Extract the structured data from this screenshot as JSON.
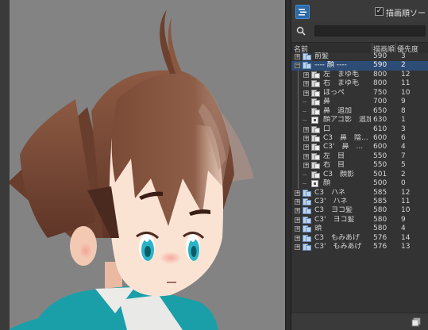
{
  "panel": {
    "draw_order_sort_label": "描画順ソート",
    "draw_order_sort_checked": "✓",
    "search_placeholder": "",
    "columns": {
      "name": "名前",
      "order": "描画順",
      "priority": "優先度"
    }
  },
  "parts": [
    {
      "name": "前髪",
      "order": "590",
      "priority": "3",
      "depth": 0,
      "expander": "+",
      "icon": "folder",
      "selected": false
    },
    {
      "name": "---- 顔 ----",
      "order": "590",
      "priority": "2",
      "depth": 0,
      "expander": "−",
      "icon": "folder",
      "selected": true
    },
    {
      "name": "左　まゆ毛",
      "order": "800",
      "priority": "12",
      "depth": 1,
      "expander": "+",
      "icon": "part",
      "selected": false
    },
    {
      "name": "右　まゆ毛",
      "order": "800",
      "priority": "11",
      "depth": 1,
      "expander": "+",
      "icon": "part",
      "selected": false
    },
    {
      "name": "ほっぺ",
      "order": "750",
      "priority": "10",
      "depth": 1,
      "expander": "+",
      "icon": "part",
      "selected": false
    },
    {
      "name": "鼻",
      "order": "700",
      "priority": "9",
      "depth": 1,
      "expander": "",
      "icon": "part",
      "selected": false
    },
    {
      "name": "鼻　追加",
      "order": "650",
      "priority": "8",
      "depth": 1,
      "expander": "",
      "icon": "part",
      "selected": false
    },
    {
      "name": "顔アゴ影　追加",
      "order": "630",
      "priority": "1",
      "depth": 1,
      "expander": "",
      "icon": "mesh",
      "selected": false
    },
    {
      "name": "口",
      "order": "610",
      "priority": "3",
      "depth": 1,
      "expander": "+",
      "icon": "part",
      "selected": false
    },
    {
      "name": "C3　鼻　陰...",
      "order": "600",
      "priority": "6",
      "depth": 1,
      "expander": "+",
      "icon": "part",
      "selected": false
    },
    {
      "name": "C3'　鼻　...",
      "order": "600",
      "priority": "4",
      "depth": 1,
      "expander": "+",
      "icon": "part",
      "selected": false
    },
    {
      "name": "左　目",
      "order": "550",
      "priority": "7",
      "depth": 1,
      "expander": "+",
      "icon": "part",
      "selected": false
    },
    {
      "name": "右　目",
      "order": "550",
      "priority": "5",
      "depth": 1,
      "expander": "+",
      "icon": "part",
      "selected": false
    },
    {
      "name": "C3　顔影",
      "order": "501",
      "priority": "2",
      "depth": 1,
      "expander": "",
      "icon": "part",
      "selected": false
    },
    {
      "name": "顔",
      "order": "500",
      "priority": "0",
      "depth": 1,
      "expander": "",
      "icon": "mesh",
      "selected": false
    },
    {
      "name": "C3　ハネ",
      "order": "585",
      "priority": "12",
      "depth": 0,
      "expander": "+",
      "icon": "folder",
      "selected": false
    },
    {
      "name": "C3'　ハネ",
      "order": "585",
      "priority": "11",
      "depth": 0,
      "expander": "+",
      "icon": "folder",
      "selected": false
    },
    {
      "name": "C3　ヨコ髪",
      "order": "580",
      "priority": "10",
      "depth": 0,
      "expander": "+",
      "icon": "folder",
      "selected": false
    },
    {
      "name": "C3'　ヨコ髪",
      "order": "580",
      "priority": "9",
      "depth": 0,
      "expander": "+",
      "icon": "folder",
      "selected": false
    },
    {
      "name": "頭",
      "order": "580",
      "priority": "4",
      "depth": 0,
      "expander": "+",
      "icon": "folder",
      "selected": false
    },
    {
      "name": "C3　もみあげ",
      "order": "576",
      "priority": "14",
      "depth": 0,
      "expander": "+",
      "icon": "folder",
      "selected": false
    },
    {
      "name": "C3'　もみあげ",
      "order": "576",
      "priority": "13",
      "depth": 0,
      "expander": "+",
      "icon": "folder",
      "selected": false
    }
  ],
  "colors": {
    "canvas_bg": "#838383",
    "selection": "#2d4c75",
    "hair": "#7a4a35",
    "skin": "#fbe3d3",
    "shirt": "#1a9fa8",
    "eye": "#2ab3c6"
  }
}
